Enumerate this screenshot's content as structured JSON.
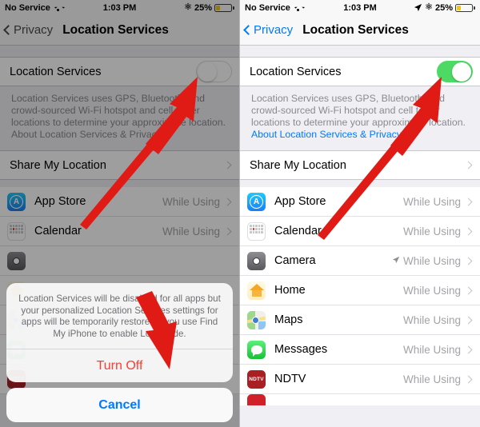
{
  "screens": [
    {
      "id": "before",
      "dimmed": true,
      "status": {
        "carrier": "No Service",
        "wifi_icon": "wifi-icon",
        "time": "1:03 PM",
        "location_arrow_visible": false,
        "bluetooth_icon": "bluetooth-icon",
        "battery_percent": "25%",
        "battery_level": 25
      },
      "nav": {
        "back_label": "Privacy",
        "title": "Location Services"
      },
      "toggle_row": {
        "label": "Location Services",
        "state": "off"
      },
      "footnote": {
        "text": "Location Services uses GPS, Bluetooth, and crowd-sourced Wi-Fi hotspot and cell tower locations to determine your approximate location. ",
        "link": "About Location Services & Privacy..."
      },
      "share_row": {
        "label": "Share My Location"
      },
      "apps": [
        {
          "name": "App Store",
          "value": "While Using",
          "icon": "appstore-icon",
          "arrow": false
        },
        {
          "name": "Calendar",
          "value": "While Using",
          "icon": "calendar-icon",
          "arrow": false
        }
      ],
      "alert": {
        "message": "Location Services will be disabled for all apps but your personalized Location Services settings for apps will be temporarily restored if you use Find My iPhone to enable Lost Mode.",
        "destructive_label": "Turn Off",
        "cancel_label": "Cancel"
      }
    },
    {
      "id": "after",
      "dimmed": false,
      "status": {
        "carrier": "No Service",
        "wifi_icon": "wifi-icon",
        "time": "1:03 PM",
        "location_arrow_visible": true,
        "bluetooth_icon": "bluetooth-icon",
        "battery_percent": "25%",
        "battery_level": 25
      },
      "nav": {
        "back_label": "Privacy",
        "title": "Location Services"
      },
      "toggle_row": {
        "label": "Location Services",
        "state": "on"
      },
      "footnote": {
        "text": "Location Services uses GPS, Bluetooth, and crowd-sourced Wi-Fi hotspot and cell tower locations to determine your approximate location. ",
        "link": "About Location Services & Privacy..."
      },
      "share_row": {
        "label": "Share My Location"
      },
      "apps": [
        {
          "name": "App Store",
          "value": "While Using",
          "icon": "appstore-icon",
          "arrow": false
        },
        {
          "name": "Calendar",
          "value": "While Using",
          "icon": "calendar-icon",
          "arrow": false
        },
        {
          "name": "Camera",
          "value": "While Using",
          "icon": "camera-icon",
          "arrow": true
        },
        {
          "name": "Home",
          "value": "While Using",
          "icon": "home-icon",
          "arrow": false
        },
        {
          "name": "Maps",
          "value": "While Using",
          "icon": "maps-icon",
          "arrow": false
        },
        {
          "name": "Messages",
          "value": "While Using",
          "icon": "messages-icon",
          "arrow": false
        },
        {
          "name": "NDTV",
          "value": "While Using",
          "icon": "ndtv-icon",
          "arrow": false
        }
      ]
    }
  ],
  "colors": {
    "toggle_on": "#4cd964",
    "tint_blue": "#007aff",
    "destructive_red": "#ff3b30",
    "annotation_red": "#e01b16",
    "battery_yellow": "#f0c419"
  },
  "annotations": [
    {
      "name": "arrow-to-toggle-off",
      "target": "left-location-services-toggle"
    },
    {
      "name": "arrow-to-turn-off-button",
      "target": "left-turn-off-button"
    },
    {
      "name": "arrow-to-toggle-on",
      "target": "right-location-services-toggle"
    }
  ],
  "ndtv_icon_text": "NDTV"
}
